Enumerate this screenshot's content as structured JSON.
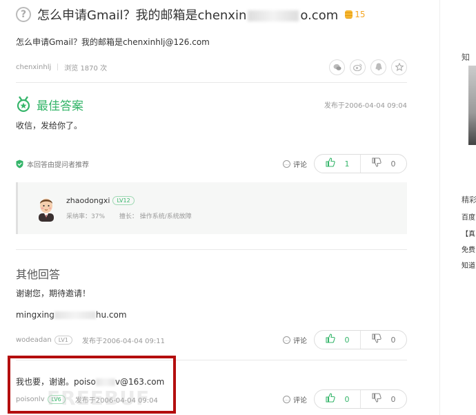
{
  "question": {
    "icon": "question-circle-icon",
    "title_prefix": "怎么申请Gmail？我的邮箱是chenxin",
    "title_suffix": "o.com",
    "reward": "15",
    "description": "怎么申请Gmail？我的邮箱是chenxinhlj@126.com",
    "author": "chenxinhlj",
    "views": "浏览 1870 次"
  },
  "best_answer": {
    "label": "最佳答案",
    "time": "发布于2006-04-04 09:04",
    "text": "收信，发给你了。",
    "recommend": "本回答由提问者推荐",
    "comment_label": "评论",
    "up": "1",
    "down": "0",
    "answerer": {
      "name": "zhaodongxi",
      "level": "LV12",
      "adopt_rate": "采纳率：37%",
      "expertise": "擅长：   操作系统/系统故障"
    }
  },
  "other_answers": {
    "heading": "其他回答",
    "items": [
      {
        "text": "谢谢您，期待邀请！",
        "text2_prefix": "mingxing",
        "text2_suffix": "hu.com",
        "user": "wodeadan",
        "level": "LV1",
        "time": "发布于2006-04-04 09:11",
        "comment_label": "评论",
        "up": "0",
        "down": "0"
      },
      {
        "text_prefix": "我也要，谢谢。poiso",
        "text_suffix": "v@163.com",
        "user": "poisonlv",
        "level": "LV6",
        "time": "发布于2006-04-04 09:04",
        "comment_label": "评论",
        "up": "0",
        "down": "0"
      }
    ]
  },
  "sidebar": {
    "top_char": "知",
    "section": "精彩",
    "items": [
      "百度",
      "【真",
      "免费",
      "知道"
    ]
  },
  "colors": {
    "green": "#35b56a",
    "highlight": "#b40e0e",
    "coin": "#f5a623"
  }
}
